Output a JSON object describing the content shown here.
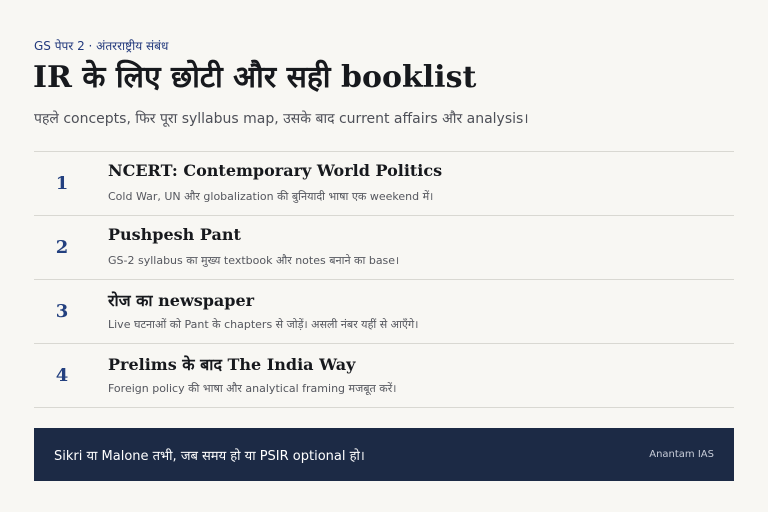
{
  "header": {
    "eyebrow": "GS पेपर 2 · अंतरराष्ट्रीय संबंध",
    "title": "IR के लिए छोटी और सही booklist",
    "subtitle": "पहले concepts, फिर पूरा syllabus map, उसके बाद current affairs और analysis।"
  },
  "booklist": [
    {
      "number": "1",
      "title": "NCERT: Contemporary World Politics",
      "description": "Cold War, UN और globalization की बुनियादी भाषा एक weekend में।"
    },
    {
      "number": "2",
      "title": "Pushpesh Pant",
      "description": "GS-2 syllabus का मुख्य textbook और notes बनाने का base।"
    },
    {
      "number": "3",
      "title": "रोज का newspaper",
      "description": "Live घटनाओं को Pant के chapters से जोड़ें। असली नंबर यहीं से आएँगे।"
    },
    {
      "number": "4",
      "title": "Prelims के बाद The India Way",
      "description": "Foreign policy की भाषा और analytical framing मजबूत करें।"
    }
  ],
  "footer": {
    "note": "Sikri या Malone तभी, जब समय हो या PSIR optional हो।",
    "brand": "Anantam IAS"
  },
  "colors": {
    "background": "#f8f7f3",
    "accent": "#23407f",
    "footer_background": "#1c2a45"
  }
}
